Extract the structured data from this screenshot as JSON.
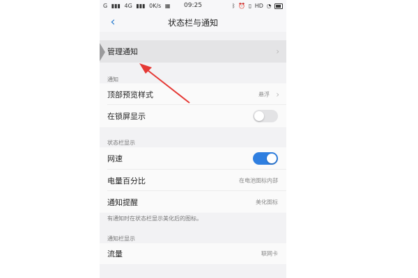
{
  "status_bar": {
    "network": "G",
    "signal": "4G",
    "speed": "0K/s",
    "time": "09:25",
    "right": "HD"
  },
  "header": {
    "title": "状态栏与通知"
  },
  "manage_notifications": {
    "label": "管理通知"
  },
  "notification_section": {
    "header": "通知",
    "top_preview_style": {
      "label": "顶部预览样式",
      "value": "悬浮"
    },
    "lockscreen_show": {
      "label": "在锁屏显示",
      "enabled": false
    }
  },
  "statusbar_section": {
    "header": "状态栏显示",
    "network_speed": {
      "label": "网速",
      "enabled": true
    },
    "battery_percent": {
      "label": "电量百分比",
      "value": "在电池图标内部"
    },
    "notification_reminder": {
      "label": "通知提醒",
      "value": "美化图标"
    },
    "hint": "有通知时在状态栏显示美化后的图标。"
  },
  "notificationbar_section": {
    "header": "通知栏显示",
    "data_usage": {
      "label": "流量",
      "value": "联网卡"
    }
  },
  "colors": {
    "accent": "#2f7fe0",
    "annotation": "#e53935"
  }
}
